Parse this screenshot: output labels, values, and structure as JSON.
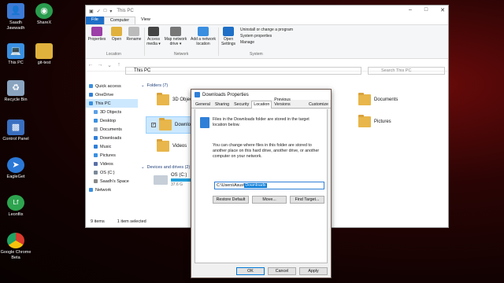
{
  "desktop": {
    "icons": [
      {
        "label": "Saadh Jawwadh",
        "color": "#3d7bd6",
        "icon": "user-folder-icon"
      },
      {
        "label": "ShareX",
        "color": "#2a9d4e",
        "icon": "sharex-icon"
      },
      {
        "label": "This PC",
        "color": "#3a8fe0",
        "icon": "computer-icon"
      },
      {
        "label": "git-test",
        "color": "#e0b13d",
        "icon": "folder-icon"
      },
      {
        "label": "Recycle Bin",
        "color": "#8aa4c0",
        "icon": "recycle-bin-icon"
      },
      {
        "label": "Control Panel",
        "color": "#3a6fc0",
        "icon": "control-panel-icon"
      },
      {
        "label": "EagleGet",
        "color": "#2a78d6",
        "icon": "eagleget-icon"
      },
      {
        "label": "Leonflix",
        "color": "#2ea44f",
        "icon": "leonflix-icon"
      },
      {
        "label": "Google Chrome Beta",
        "color": "#d83b2d",
        "icon": "chrome-icon"
      }
    ]
  },
  "explorer": {
    "title": "This PC",
    "tabs": [
      "File",
      "Computer",
      "View"
    ],
    "ribbon": {
      "location_items": [
        "Properties",
        "Open",
        "Rename"
      ],
      "network_items": [
        "Access media ▾",
        "Map network drive ▾",
        "Add a network location"
      ],
      "settings_label": "Open Settings",
      "system_items": [
        "Uninstall or change a program",
        "System properties",
        "Manage"
      ],
      "group_location": "Location",
      "group_network": "Network",
      "group_system": "System"
    },
    "address": "This PC",
    "search_placeholder": "Search This PC",
    "nav": [
      {
        "label": "Quick access",
        "color": "#3a8fe0"
      },
      {
        "label": "OneDrive",
        "color": "#2f7fd8"
      },
      {
        "label": "This PC",
        "color": "#3a8fe0"
      },
      {
        "label": "3D Objects",
        "color": "#5aa0e8"
      },
      {
        "label": "Desktop",
        "color": "#3a8fe0"
      },
      {
        "label": "Documents",
        "color": "#9aa8b8"
      },
      {
        "label": "Downloads",
        "color": "#2f7fd8"
      },
      {
        "label": "Music",
        "color": "#2f7fd8"
      },
      {
        "label": "Pictures",
        "color": "#3a8fe0"
      },
      {
        "label": "Videos",
        "color": "#5a6fa8"
      },
      {
        "label": "OS (C:)",
        "color": "#7a8898"
      },
      {
        "label": "Saadh's Space",
        "color": "#888888"
      },
      {
        "label": "Network",
        "color": "#3a8fe0"
      }
    ],
    "folders_header": "Folders (7)",
    "folders": [
      "3D Objects",
      "Downloads",
      "Videos",
      "Documents",
      "Pictures"
    ],
    "drives_header": "Devices and drives (2)",
    "drive_label": "OS (C:)",
    "drive_free": "37.6 G",
    "status_items": "9 items",
    "status_selected": "1 item selected"
  },
  "dialog": {
    "title": "Downloads Properties",
    "tabs": [
      "General",
      "Sharing",
      "Security",
      "Location",
      "Previous Versions",
      "Customize"
    ],
    "info_text": "Files in the Downloads folder are stored in the target location below.",
    "change_text": "You can change where files in this folder are stored to another place on this hard drive, another drive, or another computer on your network.",
    "path_prefix": "C:\\Users\\Asus\\",
    "path_selected": "Downloads",
    "buttons": {
      "restore": "Restore Default",
      "move": "Move...",
      "find": "Find Target...",
      "ok": "OK",
      "cancel": "Cancel",
      "apply": "Apply"
    }
  }
}
